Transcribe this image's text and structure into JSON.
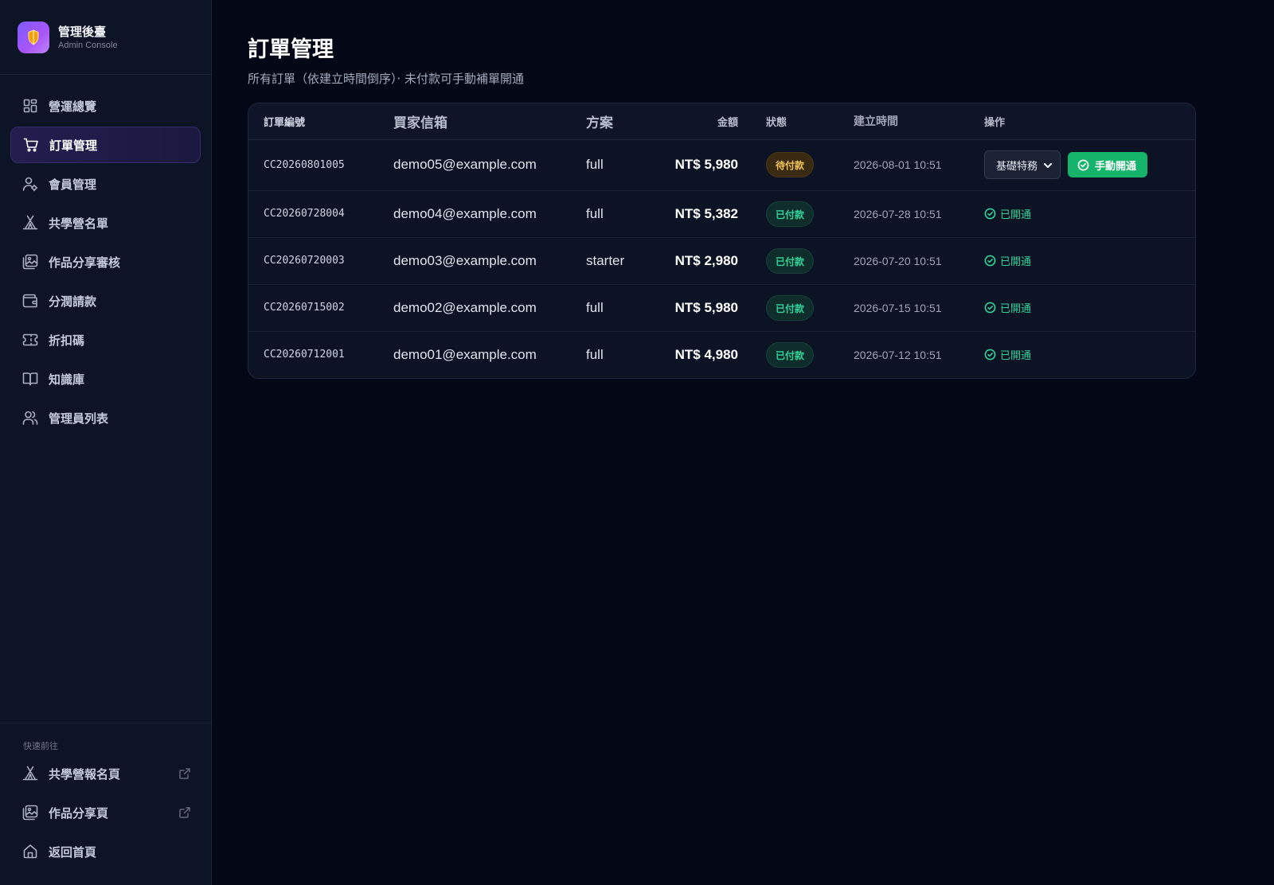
{
  "brand": {
    "title": "管理後臺",
    "subtitle": "Admin Console"
  },
  "sidebar": {
    "items": [
      {
        "label": "營運總覽",
        "icon": "dashboard-icon"
      },
      {
        "label": "訂單管理",
        "icon": "cart-icon",
        "active": true
      },
      {
        "label": "會員管理",
        "icon": "user-settings-icon"
      },
      {
        "label": "共學營名單",
        "icon": "tent-icon"
      },
      {
        "label": "作品分享審核",
        "icon": "gallery-icon"
      },
      {
        "label": "分潤請款",
        "icon": "wallet-icon"
      },
      {
        "label": "折扣碼",
        "icon": "ticket-icon"
      },
      {
        "label": "知識庫",
        "icon": "book-icon"
      },
      {
        "label": "管理員列表",
        "icon": "users-icon"
      }
    ],
    "quick_title": "快速前往",
    "quick_links": [
      {
        "label": "共學營報名頁",
        "icon": "tent-icon",
        "external": true
      },
      {
        "label": "作品分享頁",
        "icon": "gallery-icon",
        "external": true
      },
      {
        "label": "返回首頁",
        "icon": "home-icon",
        "external": false
      }
    ]
  },
  "page": {
    "title": "訂單管理",
    "subtitle": "所有訂單（依建立時間倒序）‧ 未付款可手動補單開通"
  },
  "table": {
    "headers": [
      "訂單編號",
      "買家信箱",
      "方案",
      "金額",
      "狀態",
      "建立時間",
      "操作"
    ],
    "rows": [
      {
        "order_id": "CC20260801005",
        "email": "demo05@example.com",
        "plan": "full",
        "amount": "NT$ 5,980",
        "status": "待付款",
        "status_type": "pending",
        "created": "2026-08-01 10:51",
        "action": {
          "select": "基礎特務",
          "button": "手動開通"
        }
      },
      {
        "order_id": "CC20260728004",
        "email": "demo04@example.com",
        "plan": "full",
        "amount": "NT$ 5,382",
        "status": "已付款",
        "status_type": "paid",
        "created": "2026-07-28 10:51",
        "action": {
          "label": "已開通"
        }
      },
      {
        "order_id": "CC20260720003",
        "email": "demo03@example.com",
        "plan": "starter",
        "amount": "NT$ 2,980",
        "status": "已付款",
        "status_type": "paid",
        "created": "2026-07-20 10:51",
        "action": {
          "label": "已開通"
        }
      },
      {
        "order_id": "CC20260715002",
        "email": "demo02@example.com",
        "plan": "full",
        "amount": "NT$ 5,980",
        "status": "已付款",
        "status_type": "paid",
        "created": "2026-07-15 10:51",
        "action": {
          "label": "已開通"
        }
      },
      {
        "order_id": "CC20260712001",
        "email": "demo01@example.com",
        "plan": "full",
        "amount": "NT$ 4,980",
        "status": "已付款",
        "status_type": "paid",
        "created": "2026-07-12 10:51",
        "action": {
          "label": "已開通"
        }
      }
    ]
  },
  "colors": {
    "accent": "#7c5cff",
    "success": "#16b46a",
    "pending": "#f5c45a",
    "paid": "#34d399"
  }
}
